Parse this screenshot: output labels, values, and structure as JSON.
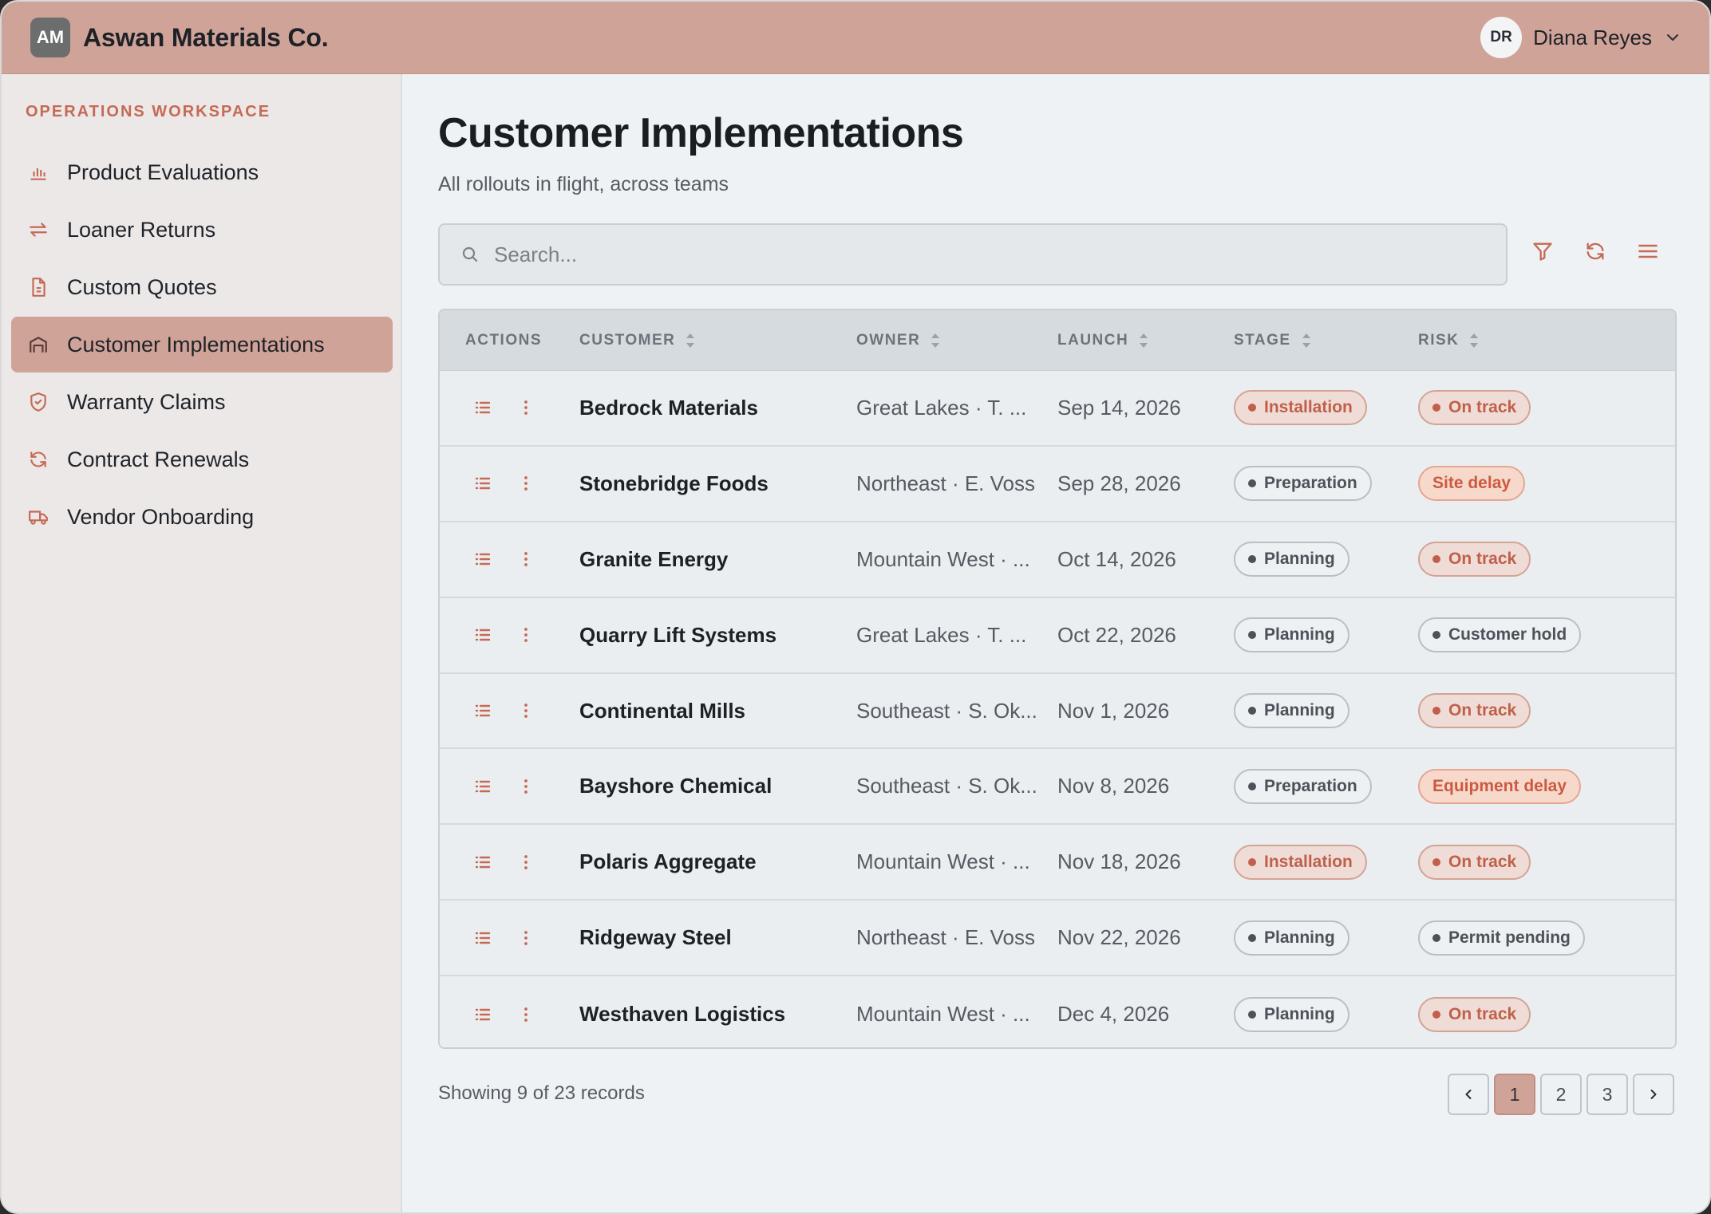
{
  "app": {
    "logo_initials": "AM",
    "name": "Aswan Materials Co."
  },
  "user": {
    "initials": "DR",
    "name": "Diana Reyes"
  },
  "sidebar": {
    "heading": "OPERATIONS WORKSPACE",
    "items": [
      {
        "label": "Product Evaluations",
        "icon": "bar-chart-icon"
      },
      {
        "label": "Loaner Returns",
        "icon": "swap-arrows-icon"
      },
      {
        "label": "Custom Quotes",
        "icon": "document-icon"
      },
      {
        "label": "Customer Implementations",
        "icon": "warehouse-icon",
        "active": true
      },
      {
        "label": "Warranty Claims",
        "icon": "shield-icon"
      },
      {
        "label": "Contract Renewals",
        "icon": "refresh-icon"
      },
      {
        "label": "Vendor Onboarding",
        "icon": "truck-icon"
      }
    ]
  },
  "main": {
    "title": "Customer Implementations",
    "subtitle": "All rollouts in flight, across teams",
    "search_placeholder": "Search...",
    "search_value": ""
  },
  "table": {
    "headers": {
      "actions": "ACTIONS",
      "customer": "CUSTOMER",
      "owner": "OWNER",
      "launch": "LAUNCH",
      "stage": "STAGE",
      "risk": "RISK"
    },
    "rows": [
      {
        "customer": "Bedrock Materials",
        "owner": "Great Lakes · T. ...",
        "launch": "Sep 14, 2026",
        "stage": "Installation",
        "risk": "On track"
      },
      {
        "customer": "Stonebridge Foods",
        "owner": "Northeast · E. Voss",
        "launch": "Sep 28, 2026",
        "stage": "Preparation",
        "risk": "Site delay"
      },
      {
        "customer": "Granite Energy",
        "owner": "Mountain West · ...",
        "launch": "Oct 14, 2026",
        "stage": "Planning",
        "risk": "On track"
      },
      {
        "customer": "Quarry Lift Systems",
        "owner": "Great Lakes · T. ...",
        "launch": "Oct 22, 2026",
        "stage": "Planning",
        "risk": "Customer hold"
      },
      {
        "customer": "Continental Mills",
        "owner": "Southeast · S. Ok...",
        "launch": "Nov 1, 2026",
        "stage": "Planning",
        "risk": "On track"
      },
      {
        "customer": "Bayshore Chemical",
        "owner": "Southeast · S. Ok...",
        "launch": "Nov 8, 2026",
        "stage": "Preparation",
        "risk": "Equipment delay"
      },
      {
        "customer": "Polaris Aggregate",
        "owner": "Mountain West · ...",
        "launch": "Nov 18, 2026",
        "stage": "Installation",
        "risk": "On track"
      },
      {
        "customer": "Ridgeway Steel",
        "owner": "Northeast · E. Voss",
        "launch": "Nov 22, 2026",
        "stage": "Planning",
        "risk": "Permit pending"
      },
      {
        "customer": "Westhaven Logistics",
        "owner": "Mountain West · ...",
        "launch": "Dec 4, 2026",
        "stage": "Planning",
        "risk": "On track"
      }
    ]
  },
  "footer": {
    "showing": "Showing 9 of 23 records",
    "pages": [
      "1",
      "2",
      "3"
    ],
    "current_page": "1"
  },
  "colors": {
    "accent": "#d0a399",
    "accent_text": "#c56a55",
    "neutral_pill": "#eef1f3",
    "alert_pill": "#f7d9cc"
  }
}
